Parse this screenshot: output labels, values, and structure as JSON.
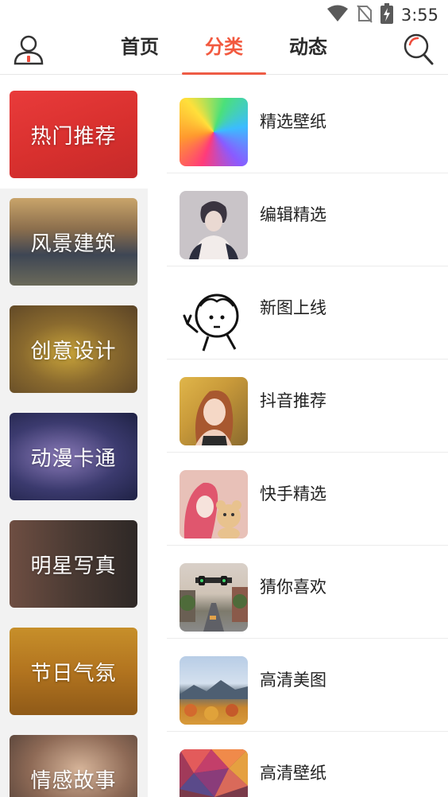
{
  "status_bar": {
    "time": "3:55",
    "icons": [
      "wifi-icon",
      "no-sim-icon",
      "battery-charging-icon"
    ]
  },
  "header": {
    "tabs": [
      {
        "label": "首页",
        "active": false
      },
      {
        "label": "分类",
        "active": true
      },
      {
        "label": "动态",
        "active": false
      }
    ],
    "accent_color": "#f2593f",
    "left_icon": "user-icon",
    "right_icon": "search-icon"
  },
  "sidebar": {
    "items": [
      {
        "label": "热门推荐",
        "selected": true
      },
      {
        "label": "风景建筑",
        "selected": false
      },
      {
        "label": "创意设计",
        "selected": false
      },
      {
        "label": "动漫卡通",
        "selected": false
      },
      {
        "label": "明星写真",
        "selected": false
      },
      {
        "label": "节日气氛",
        "selected": false
      },
      {
        "label": "情感故事",
        "selected": false
      }
    ]
  },
  "list": {
    "items": [
      {
        "title": "精选壁纸"
      },
      {
        "title": "编辑精选"
      },
      {
        "title": "新图上线"
      },
      {
        "title": "抖音推荐"
      },
      {
        "title": "快手精选"
      },
      {
        "title": "猜你喜欢"
      },
      {
        "title": "高清美图"
      },
      {
        "title": "高清壁纸"
      }
    ]
  }
}
